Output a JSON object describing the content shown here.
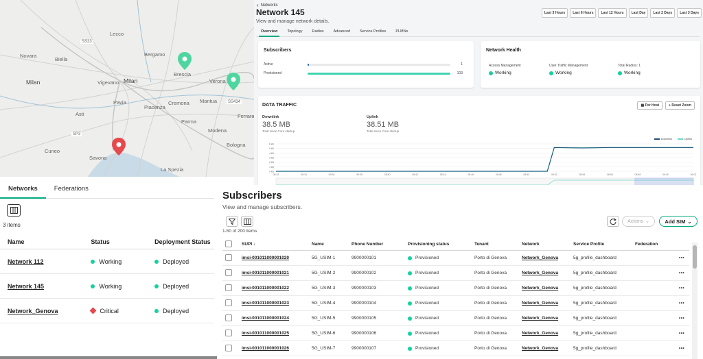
{
  "map": {
    "cities": [
      {
        "name": "Novara",
        "cls": ""
      },
      {
        "name": "Milan",
        "cls": "big"
      },
      {
        "name": "Bergamo",
        "cls": ""
      },
      {
        "name": "Brescia",
        "cls": ""
      },
      {
        "name": "Verona",
        "cls": ""
      },
      {
        "name": "Biella",
        "cls": ""
      },
      {
        "name": "Vigevano",
        "cls": ""
      },
      {
        "name": "Pavia",
        "cls": ""
      },
      {
        "name": "Piacenza",
        "cls": ""
      },
      {
        "name": "Cremona",
        "cls": ""
      },
      {
        "name": "Mantua",
        "cls": ""
      },
      {
        "name": "Parma",
        "cls": ""
      },
      {
        "name": "Modena",
        "cls": ""
      },
      {
        "name": "Bologna",
        "cls": ""
      },
      {
        "name": "Cuneo",
        "cls": ""
      },
      {
        "name": "Savona",
        "cls": ""
      },
      {
        "name": "La Spezia",
        "cls": ""
      },
      {
        "name": "Ferrara",
        "cls": ""
      },
      {
        "name": "Lecco",
        "cls": ""
      },
      {
        "name": "Asti",
        "cls": ""
      }
    ],
    "road_labels": [
      "SS33",
      "SS434",
      "SP3"
    ],
    "pin_colors": {
      "working": "#4fd6a0",
      "critical": "#e5484d"
    }
  },
  "detail": {
    "breadcrumb": "Networks",
    "title": "Network 145",
    "subtitle": "View and manage network details.",
    "time_ranges": [
      "Last 3 Hours",
      "Last 6 Hours",
      "Last 12 Hours",
      "Last Day",
      "Last 2 Days",
      "Last 3 Days"
    ],
    "tabs": [
      "Overview",
      "Topology",
      "Radios",
      "Advanced",
      "Service Profiles",
      "PLMNs"
    ],
    "subscribers_card": {
      "title": "Subscribers",
      "active_label": "Active",
      "active_value": "1",
      "active_fraction": 0.01,
      "provisioned_label": "Provisioned",
      "provisioned_value": "103",
      "provisioned_fraction": 1.0
    },
    "health_card": {
      "title": "Network Health",
      "items": [
        {
          "label": "Access Management",
          "value": "Working"
        },
        {
          "label": "User Traffic Management",
          "value": "Working"
        },
        {
          "label": "Total Radios: 1",
          "value": "Working"
        }
      ]
    },
    "traffic": {
      "title": "DATA TRAFFIC",
      "per_host": "Per Host",
      "reset_zoom": "Reset Zoom",
      "downlink_label": "Downlink",
      "downlink_value": "38.5 MB",
      "downlink_sub": "Total since Core startup",
      "uplink_label": "Uplink",
      "uplink_value": "38.51 MB",
      "uplink_sub": "Total since Core startup",
      "legend": [
        "Downlink",
        "Uplink"
      ]
    }
  },
  "chart_data": {
    "type": "line",
    "title": "DATA TRAFFIC",
    "x": [
      "08:32",
      "08:34",
      "08:36",
      "08:38",
      "08:40",
      "08:42",
      "08:44",
      "08:46",
      "08:48",
      "08:50",
      "08:52",
      "08:54",
      "08:56",
      "08:58",
      "09:00",
      "09:02"
    ],
    "y_ticks": [
      "0 kB",
      "1 kB",
      "2 kB",
      "3 kB",
      "4 kB",
      "5 kB",
      "6 kB"
    ],
    "series": [
      {
        "name": "Downlink",
        "color": "#1f4e79",
        "values": [
          0,
          0,
          0,
          0,
          0,
          0,
          0,
          0,
          0,
          0,
          5.2,
          5.1,
          5.2,
          5.2,
          5.2,
          5.2
        ]
      },
      {
        "name": "Uplink",
        "color": "#6fd6c6",
        "values": [
          0,
          0,
          0,
          0,
          0,
          0,
          0,
          0,
          0,
          0,
          5.2,
          5.15,
          5.2,
          5.2,
          5.2,
          5.2
        ]
      }
    ],
    "ylim": [
      0,
      6
    ],
    "legend_position": "top-right",
    "grid": true
  },
  "networks": {
    "tabs": [
      "Networks",
      "Federations"
    ],
    "count": "3 items",
    "headers": [
      "Name",
      "Status",
      "Deployment Status"
    ],
    "rows": [
      {
        "name": "Network 112",
        "status": "Working",
        "status_kind": "ok",
        "deploy": "Deployed"
      },
      {
        "name": "Network 145",
        "status": "Working",
        "status_kind": "ok",
        "deploy": "Deployed"
      },
      {
        "name": "Network_Genova",
        "status": "Critical",
        "status_kind": "critical",
        "deploy": "Deployed"
      }
    ]
  },
  "subscribers": {
    "title": "Subscribers",
    "subtitle": "View and manage subscribers.",
    "count": "1-50 of 200 items",
    "actions_label": "Actions",
    "add_sim_label": "Add SIM",
    "headers": [
      "SUPI",
      "Name",
      "Phone Number",
      "Provisioning status",
      "Tenant",
      "Network",
      "Service Profile",
      "Federation"
    ],
    "rows": [
      {
        "supi": "imsi-001011000001020",
        "name": "5G_USIM-1",
        "phone": "9900000101",
        "status": "Provisioned",
        "tenant": "Porto di Genova",
        "network": "Network_Genova",
        "profile": "5g_profile_dashboard",
        "federation": ""
      },
      {
        "supi": "imsi-001011000001021",
        "name": "5G_USIM-2",
        "phone": "9900000102",
        "status": "Provisioned",
        "tenant": "Porto di Genova",
        "network": "Network_Genova",
        "profile": "5g_profile_dashboard",
        "federation": ""
      },
      {
        "supi": "imsi-001011000001022",
        "name": "5G_USIM-3",
        "phone": "9900000103",
        "status": "Provisioned",
        "tenant": "Porto di Genova",
        "network": "Network_Genova",
        "profile": "5g_profile_dashboard",
        "federation": ""
      },
      {
        "supi": "imsi-001011000001023",
        "name": "5G_USIM-4",
        "phone": "9900000104",
        "status": "Provisioned",
        "tenant": "Porto di Genova",
        "network": "Network_Genova",
        "profile": "5g_profile_dashboard",
        "federation": ""
      },
      {
        "supi": "imsi-001011000001024",
        "name": "5G_USIM-5",
        "phone": "9900000105",
        "status": "Provisioned",
        "tenant": "Porto di Genova",
        "network": "Network_Genova",
        "profile": "5g_profile_dashboard",
        "federation": ""
      },
      {
        "supi": "imsi-001011000001025",
        "name": "5G_USIM-6",
        "phone": "9900000106",
        "status": "Provisioned",
        "tenant": "Porto di Genova",
        "network": "Network_Genova",
        "profile": "5g_profile_dashboard",
        "federation": ""
      },
      {
        "supi": "imsi-001011000001026",
        "name": "5G_USIM-7",
        "phone": "9900000107",
        "status": "Provisioned",
        "tenant": "Porto di Genova",
        "network": "Network_Genova",
        "profile": "5g_profile_dashboard",
        "federation": ""
      }
    ]
  }
}
